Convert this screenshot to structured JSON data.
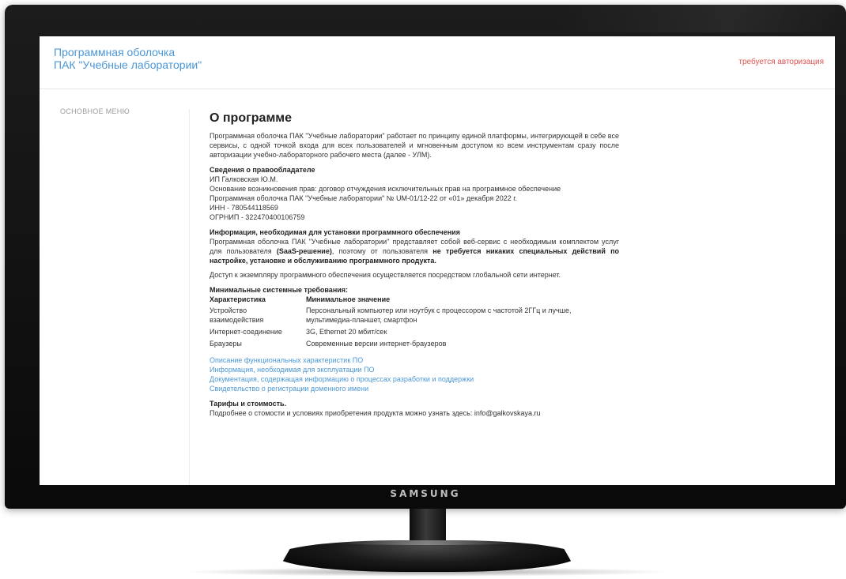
{
  "monitor": {
    "brand": "SAMSUNG"
  },
  "header": {
    "title_line1": "Программная оболочка",
    "title_line2": "ПАК \"Учебные лаборатории\"",
    "auth_link": "требуется авторизация"
  },
  "sidebar": {
    "menu_label": "ОСНОВНОЕ МЕНЮ"
  },
  "page": {
    "heading": "О программе",
    "intro": "Программная оболочка ПАК \"Учебные лаборатории\" работает по принципу единой платформы, интегрирующей в себе все сервисы, с одной точкой входа для всех пользователей и мгновенным доступом ко всем инструментам сразу после авторизации учебно-лабораторного рабочего места (далее - УЛМ).",
    "rightholder": {
      "title": "Сведения о правообладателе",
      "lines": [
        "ИП Галковская Ю.М.",
        "Основание возникновения прав: договор отчуждения исключительных прав на программное обеспечение",
        "Программная оболочка ПАК \"Учебные лаборатории\" № UM-01/12-22 от «01» декабря 2022 г.",
        "ИНН - 780544118569",
        "ОГРНИП - 322470400106759"
      ]
    },
    "install": {
      "title": "Информация, необходимая для установки программного обеспечения",
      "text_part1": "Программная оболочка ПАК \"Учебные лаборатории\" представляет собой веб-сервис с необходимым комплектом услуг для пользователя ",
      "text_bold1": "(SaaS-решение)",
      "text_part2": ", поэтому от пользователя ",
      "text_bold2": "не требуется никаких специальных действий по настройке, установке и обслуживанию программного продукта.",
      "access": "Доступ к экземпляру программного обеспечения осуществляется посредством глобальной сети интернет."
    },
    "requirements": {
      "title": "Минимальные системные требования:",
      "headers": [
        "Характеристика",
        "Минимальное значение"
      ],
      "rows": [
        [
          "Устройство взаимодействия",
          "Персональный компьютер или ноутбук с процессором с частотой 2ГГц и лучше, мультимедиа-планшет, смартфон"
        ],
        [
          "Интернет-соединение",
          "3G, Ethernet 20 мбит/сек"
        ],
        [
          "Браузеры",
          "Современные версии интернет-браузеров"
        ]
      ]
    },
    "links": [
      "Описание функциональных характеристик ПО",
      "Информация, необходимая для эксплуатации ПО",
      "Документация, содержащая информацию о процессах разработки и поддержки",
      "Свидетельство о регистрации доменного имени"
    ],
    "pricing": {
      "title": "Тарифы и стоимость.",
      "text": "Подробнее о стомости и условиях приобретения продукта можно узнать здесь: info@galkovskaya.ru"
    }
  },
  "colors": {
    "accent": "#4a97d6",
    "auth": "#e0524e"
  }
}
